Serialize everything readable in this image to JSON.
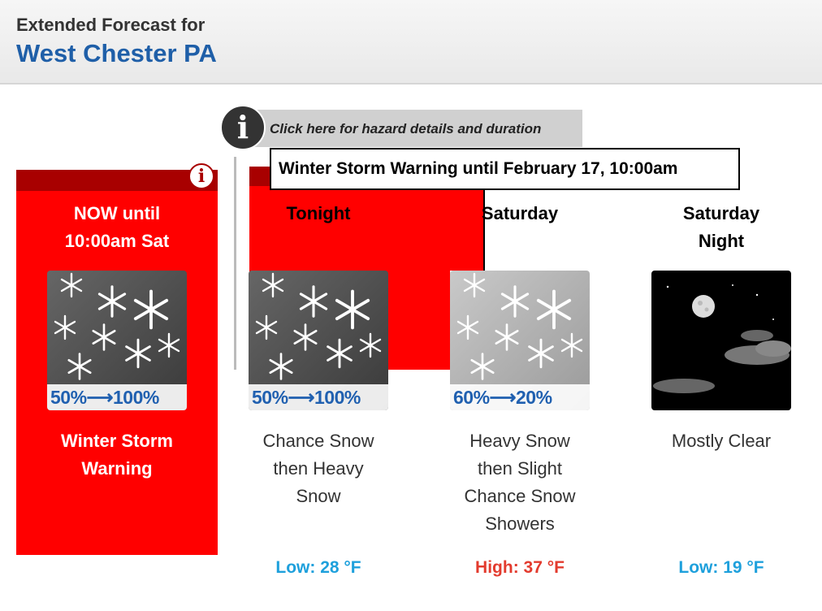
{
  "header": {
    "prefix": "Extended Forecast for",
    "location": "West Chester PA"
  },
  "hazard": {
    "link_text": "Click here for hazard details and duration",
    "tooltip": "Winter Storm Warning until February 17, 10:00am",
    "info_icon": "i"
  },
  "colors": {
    "warning_red": "#ff0000",
    "warning_dark": "#a80000",
    "low_temp": "#1ea0dc",
    "high_temp": "#e33b2e",
    "title_blue": "#1f5fa8"
  },
  "periods": [
    {
      "name_line1": "NOW until",
      "name_line2": "10:00am Sat",
      "icon": "snow-icon",
      "pop": "50%⟶100%",
      "desc": [
        "Winter Storm",
        "Warning"
      ],
      "temp": ""
    },
    {
      "name_line1": "Tonight",
      "name_line2": "",
      "icon": "snow-icon",
      "pop": "50%⟶100%",
      "desc": [
        "Chance Snow",
        "then Heavy",
        "Snow"
      ],
      "temp": "Low: 28 °F"
    },
    {
      "name_line1": "Saturday",
      "name_line2": "",
      "icon": "snow-light-icon",
      "pop": "60%⟶20%",
      "desc": [
        "Heavy Snow",
        "then Slight",
        "Chance Snow",
        "Showers"
      ],
      "temp": "High: 37 °F"
    },
    {
      "name_line1": "Saturday",
      "name_line2": "Night",
      "icon": "moon-clouds-icon",
      "pop": "",
      "desc": [
        "Mostly Clear"
      ],
      "temp": "Low: 19 °F"
    }
  ]
}
